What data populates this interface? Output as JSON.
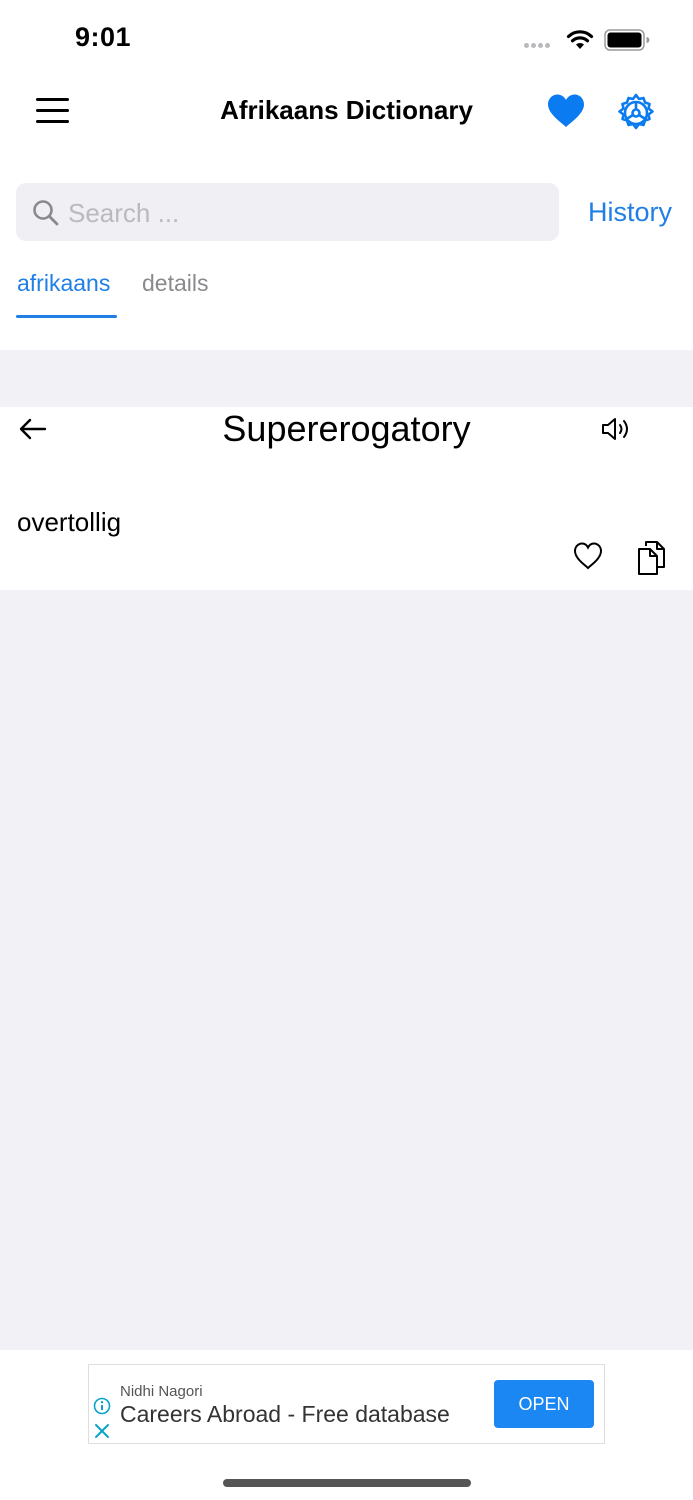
{
  "status_bar": {
    "time": "9:01"
  },
  "header": {
    "title": "Afrikaans Dictionary",
    "accent_color": "#1f7fe5"
  },
  "search": {
    "placeholder": "Search ...",
    "value": "",
    "history_label": "History"
  },
  "tabs": [
    {
      "label": "afrikaans",
      "active": true
    },
    {
      "label": "details",
      "active": false
    }
  ],
  "entry": {
    "word": "Supererogatory",
    "translation": "overtollig"
  },
  "ad": {
    "advertiser": "Nidhi Nagori",
    "headline": "Careers Abroad - Free database",
    "cta": "OPEN"
  },
  "icons": [
    "menu-icon",
    "heart-filled-icon",
    "settings-icon",
    "search-icon",
    "back-arrow-icon",
    "speaker-icon",
    "heart-outline-icon",
    "copy-icon",
    "info-icon",
    "close-icon"
  ]
}
